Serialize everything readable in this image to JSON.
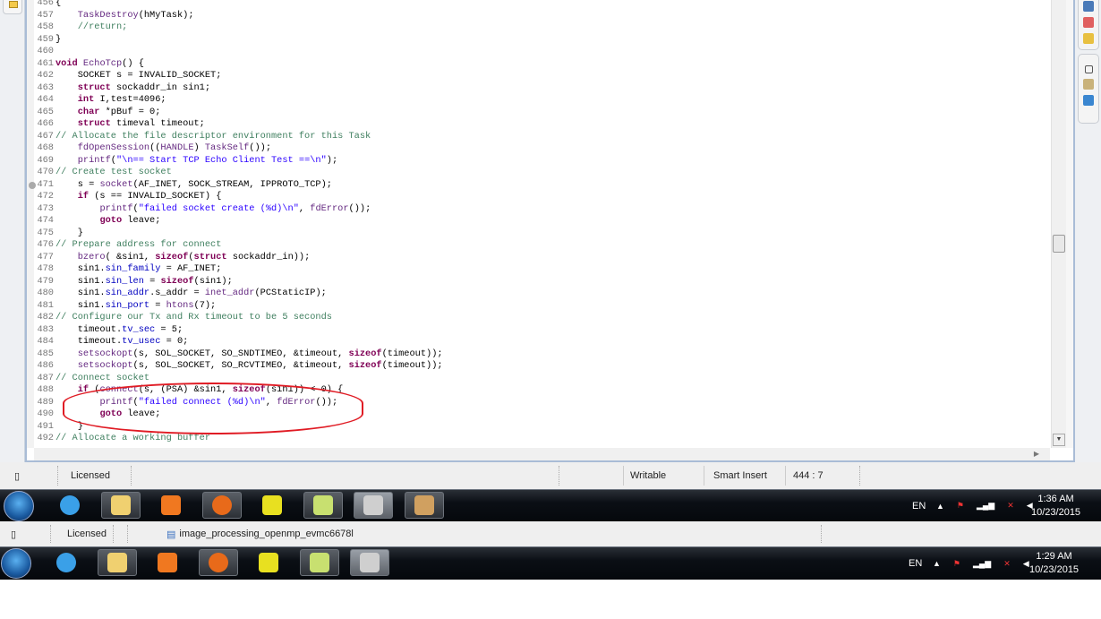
{
  "editor": {
    "breakpoint_line": 471,
    "highlight_lines": [
      488,
      491
    ],
    "highlight_color": "#e01b24",
    "lines": [
      {
        "num": 456,
        "text": "{"
      },
      {
        "num": 457,
        "text": "    TaskDestroy(hMyTask);"
      },
      {
        "num": 458,
        "text": "    //return;"
      },
      {
        "num": 459,
        "text": "}"
      },
      {
        "num": 460,
        "text": ""
      },
      {
        "num": 461,
        "text": "void EchoTcp() {"
      },
      {
        "num": 462,
        "text": "    SOCKET s = INVALID_SOCKET;"
      },
      {
        "num": 463,
        "text": "    struct sockaddr_in sin1;"
      },
      {
        "num": 464,
        "text": "    int I,test=4096;"
      },
      {
        "num": 465,
        "text": "    char *pBuf = 0;"
      },
      {
        "num": 466,
        "text": "    struct timeval timeout;"
      },
      {
        "num": 467,
        "text": "// Allocate the file descriptor environment for this Task"
      },
      {
        "num": 468,
        "text": "    fdOpenSession((HANDLE) TaskSelf());"
      },
      {
        "num": 469,
        "text": "    printf(\"\\n== Start TCP Echo Client Test ==\\n\");"
      },
      {
        "num": 470,
        "text": "// Create test socket"
      },
      {
        "num": 471,
        "text": "    s = socket(AF_INET, SOCK_STREAM, IPPROTO_TCP);"
      },
      {
        "num": 472,
        "text": "    if (s == INVALID_SOCKET) {"
      },
      {
        "num": 473,
        "text": "        printf(\"failed socket create (%d)\\n\", fdError());"
      },
      {
        "num": 474,
        "text": "        goto leave;"
      },
      {
        "num": 475,
        "text": "    }"
      },
      {
        "num": 476,
        "text": "// Prepare address for connect"
      },
      {
        "num": 477,
        "text": "    bzero( &sin1, sizeof(struct sockaddr_in));"
      },
      {
        "num": 478,
        "text": "    sin1.sin_family = AF_INET;"
      },
      {
        "num": 479,
        "text": "    sin1.sin_len = sizeof(sin1);"
      },
      {
        "num": 480,
        "text": "    sin1.sin_addr.s_addr = inet_addr(PCStaticIP);"
      },
      {
        "num": 481,
        "text": "    sin1.sin_port = htons(7);"
      },
      {
        "num": 482,
        "text": "// Configure our Tx and Rx timeout to be 5 seconds"
      },
      {
        "num": 483,
        "text": "    timeout.tv_sec = 5;"
      },
      {
        "num": 484,
        "text": "    timeout.tv_usec = 0;"
      },
      {
        "num": 485,
        "text": "    setsockopt(s, SOL_SOCKET, SO_SNDTIMEO, &timeout, sizeof(timeout));"
      },
      {
        "num": 486,
        "text": "    setsockopt(s, SOL_SOCKET, SO_RCVTIMEO, &timeout, sizeof(timeout));"
      },
      {
        "num": 487,
        "text": "// Connect socket"
      },
      {
        "num": 488,
        "text": "    if (connect(s, (PSA) &sin1, sizeof(sin1)) < 0) {"
      },
      {
        "num": 489,
        "text": "        printf(\"failed connect (%d)\\n\", fdError());"
      },
      {
        "num": 490,
        "text": "        goto leave;"
      },
      {
        "num": 491,
        "text": "    }"
      },
      {
        "num": 492,
        "text": "// Allocate a working buffer"
      }
    ]
  },
  "status_bar_top": {
    "license": "Licensed",
    "mode": "Writable",
    "insert_mode": "Smart Insert",
    "cursor_position": "444 : 7"
  },
  "taskbar_top": {
    "apps": [
      "start",
      "internet-explorer",
      "file-explorer",
      "media-player",
      "firefox",
      "ccs-tool",
      "sticky-notes",
      "cube-app",
      "paint"
    ],
    "language": "EN",
    "time": "1:36 AM",
    "date": "10/23/2015"
  },
  "status_bar_bottom": {
    "license": "Licensed",
    "project": "image_processing_openmp_evmc6678l"
  },
  "taskbar_bottom": {
    "apps": [
      "start",
      "internet-explorer",
      "file-explorer",
      "media-player",
      "firefox",
      "ccs-tool",
      "sticky-notes",
      "cube-app"
    ],
    "language": "EN",
    "time": "1:29 AM",
    "date": "10/23/2015"
  }
}
